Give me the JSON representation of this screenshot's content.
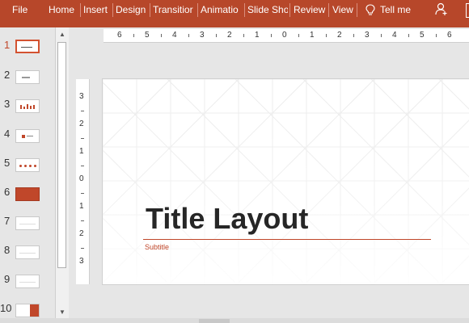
{
  "ribbon": {
    "tabs": [
      "File",
      "Home",
      "Insert",
      "Design",
      "Transitior",
      "Animatio",
      "Slide Sho",
      "Review",
      "View"
    ],
    "tell_me": "Tell me",
    "accent": "#b7472a"
  },
  "thumbnails": {
    "numbers": [
      "1",
      "2",
      "3",
      "4",
      "5",
      "6",
      "7",
      "8",
      "9",
      "10"
    ],
    "active_index": 1
  },
  "rulers": {
    "horizontal": [
      "6",
      "5",
      "4",
      "3",
      "2",
      "1",
      "0",
      "1",
      "2",
      "3",
      "4",
      "5",
      "6"
    ],
    "vertical": [
      "3",
      "2",
      "1",
      "0",
      "1",
      "2",
      "3"
    ]
  },
  "slide": {
    "title": "Title Layout",
    "subtitle": "Subtitle",
    "accent": "#c0472a"
  }
}
